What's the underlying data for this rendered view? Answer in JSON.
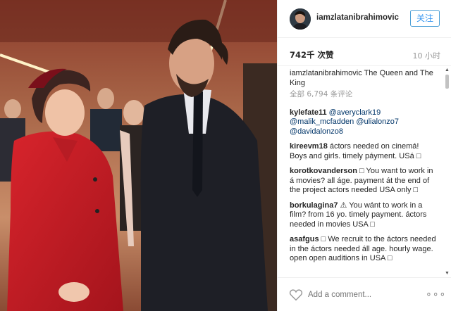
{
  "post": {
    "username": "iamzlatanibrahimovic",
    "follow_label": "关注",
    "likes_text": "742千 次赞",
    "time_text": "10 小时",
    "caption_user": "iamzlatanibrahimovic",
    "caption_text": " The Queen and The King",
    "all_comments_text": "全部 6,794 条评论"
  },
  "comments": [
    {
      "user": "kylefate11",
      "text": " @averyclark19 @malik_mcfadden @ulialonzo7 @davidalonzo8",
      "mentions": true
    },
    {
      "user": "kireevm18",
      "text": " áctors needed on cinemá! Boys and girls. timely páyment. USá □",
      "mentions": false
    },
    {
      "user": "korotkovanderson",
      "text": " □ You want to work in á movies? all áge. payment át the end of the project actors needed USA only □",
      "mentions": false
    },
    {
      "user": "borkulagina7",
      "text": " ⚠ You wánt to work in a film? from 16 yo. timely payment. áctors needed in movies USA □",
      "mentions": false
    },
    {
      "user": "asafgus",
      "text": " □ We recruit to the áctors needed in the áctors needed áll age. hourly wage. open open auditions in USA □",
      "mentions": false
    }
  ],
  "footer": {
    "add_comment_placeholder": "Add a comment...",
    "more_label": "∘∘∘"
  },
  "icons": {
    "heart": "heart-icon",
    "more": "more-options-icon",
    "scroll_up": "scroll-up-icon",
    "scroll_down": "scroll-down-icon"
  },
  "colors": {
    "follow_blue": "#3897f0",
    "mention_blue": "#003569",
    "muted_gray": "#999999"
  }
}
